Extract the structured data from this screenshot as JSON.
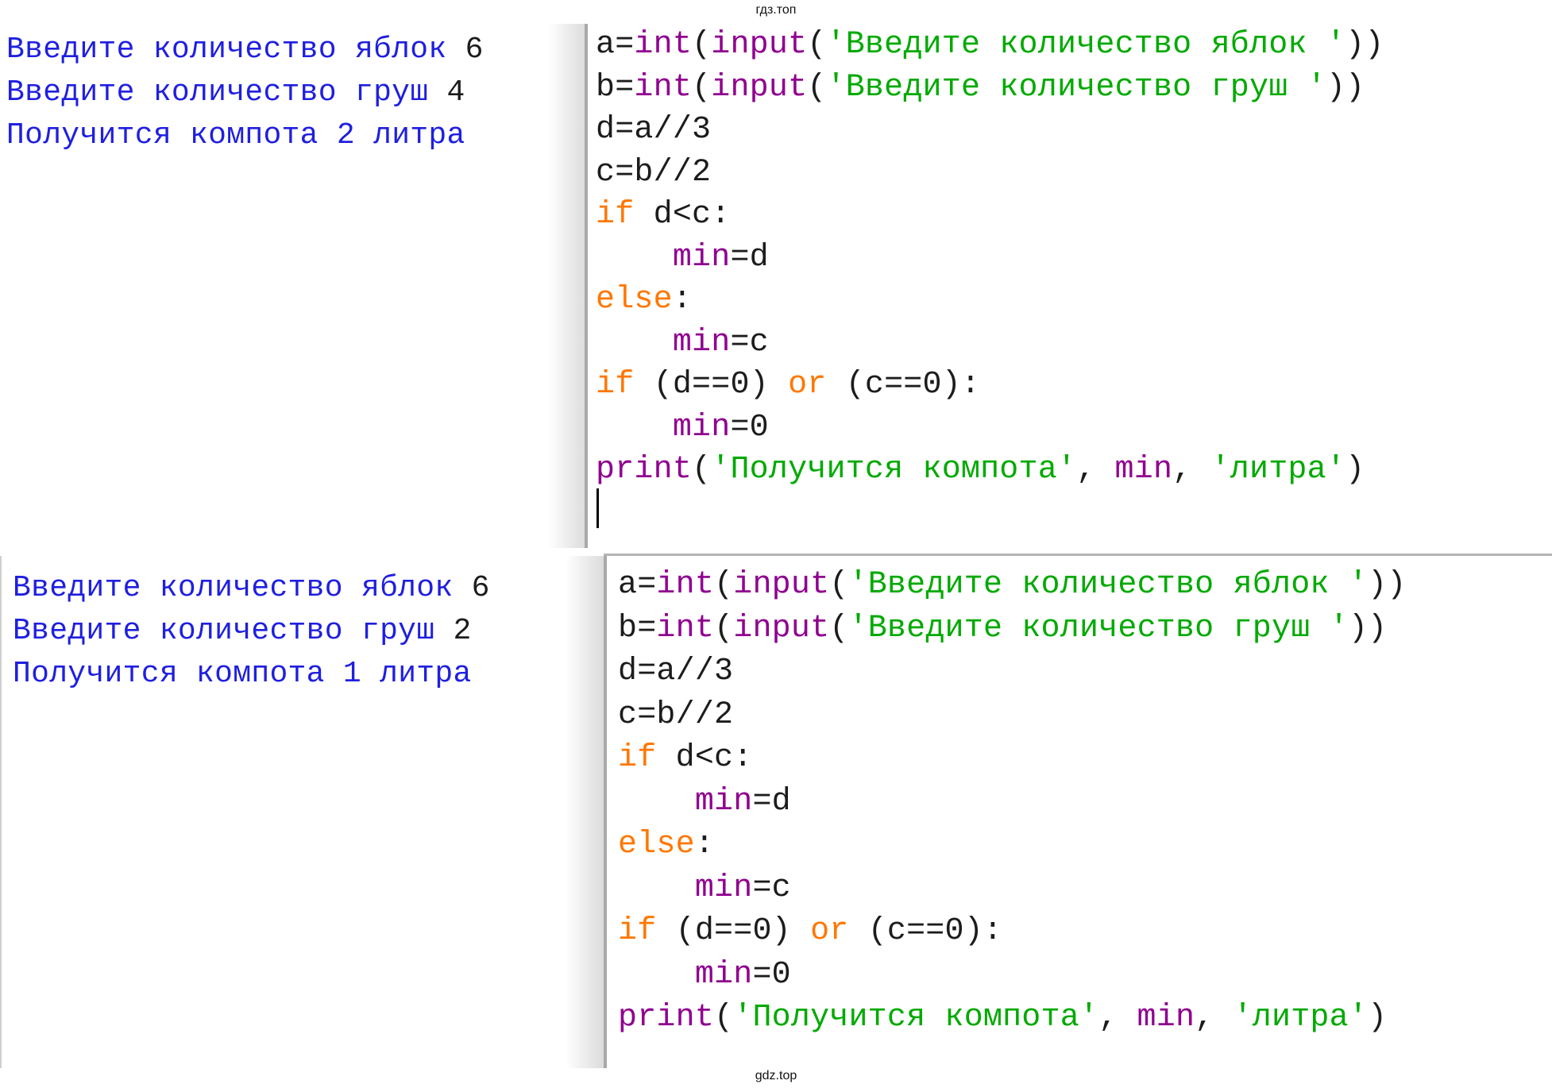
{
  "watermarks": {
    "top": "гдз.топ",
    "bottom": "gdz.top"
  },
  "runs": [
    {
      "shell": {
        "prompt_apples": "Введите количество яблок ",
        "value_apples": "6",
        "prompt_pears": "Введите количество груш ",
        "value_pears": "4",
        "result_prefix": "Получится компота ",
        "result_value": "2",
        "result_suffix": " литра"
      }
    },
    {
      "shell": {
        "prompt_apples": "Введите количество яблок ",
        "value_apples": "6",
        "prompt_pears": "Введите количество груш ",
        "value_pears": "2",
        "result_prefix": "Получится компота ",
        "result_value": "1",
        "result_suffix": " литра"
      }
    }
  ],
  "code": {
    "l1_a": "a=",
    "l1_int": "int",
    "l1_open": "(",
    "l1_input": "input",
    "l1_open2": "(",
    "l1_str": "'Введите количество яблок '",
    "l1_close": "))",
    "l2_b": "b=",
    "l2_int": "int",
    "l2_open": "(",
    "l2_input": "input",
    "l2_open2": "(",
    "l2_str": "'Введите количество груш '",
    "l2_close": "))",
    "l3": "d=a//3",
    "l4": "c=b//2",
    "l5_if": "if",
    "l5_rest": " d<c:",
    "l6_indent": "    ",
    "l6_min": "min",
    "l6_rest": "=d",
    "l7_else": "else",
    "l7_colon": ":",
    "l8_indent": "    ",
    "l8_min": "min",
    "l8_rest": "=c",
    "l9_if": "if",
    "l9_mid": " (d==0) ",
    "l9_or": "or",
    "l9_rest": " (c==0):",
    "l10_indent": "    ",
    "l10_min": "min",
    "l10_rest": "=0",
    "l11_print": "print",
    "l11_open": "(",
    "l11_str1": "'Получится компота'",
    "l11_sep1": ", ",
    "l11_min": "min",
    "l11_sep2": ", ",
    "l11_str2": "'литра'",
    "l11_close": ")"
  },
  "colors": {
    "shell_output": "#1f1fe0",
    "keyword": "#ff7700",
    "builtin": "#900090",
    "string": "#00aa00",
    "default_text": "#1c1c1c"
  }
}
